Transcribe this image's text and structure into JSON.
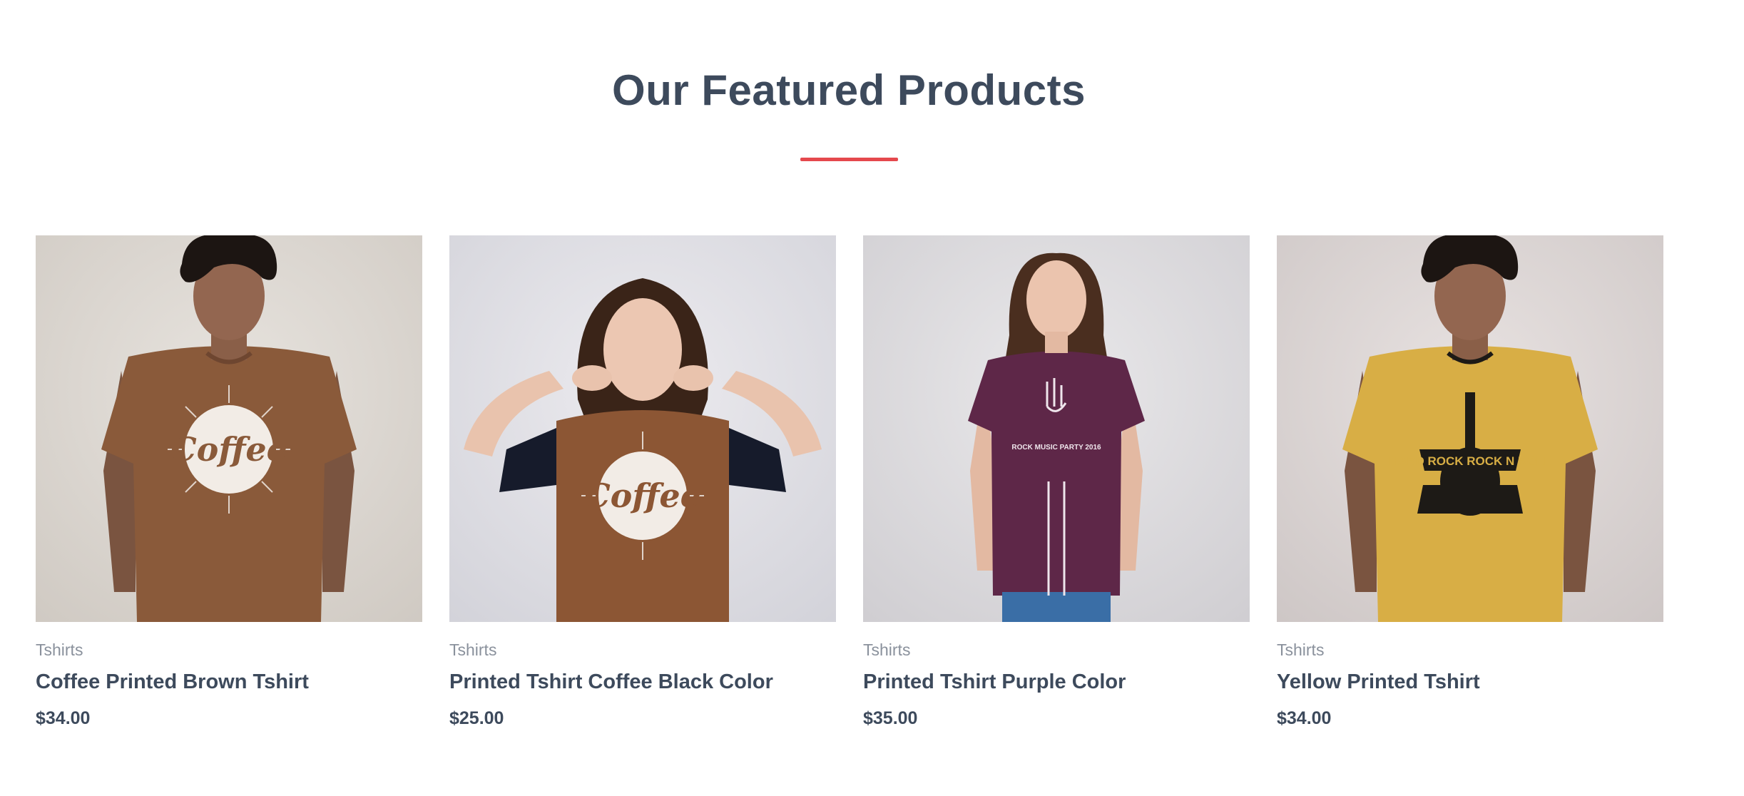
{
  "section": {
    "title": "Our Featured Products",
    "accent_color": "#e5484d"
  },
  "products": [
    {
      "category": "Tshirts",
      "name": "Coffee Printed Brown Tshirt",
      "price": "$34.00",
      "image": "photo of man wearing brown coffee print t-shirt",
      "shirt_color": "#8a5a3a",
      "print_text": "Coffee"
    },
    {
      "category": "Tshirts",
      "name": "Printed Tshirt Coffee Black Color",
      "price": "$25.00",
      "image": "photo of woman wearing brown raglan coffee print t-shirt with black sleeves",
      "shirt_color": "#8c5634",
      "sleeve_color": "#161b2b",
      "print_text": "Coffee"
    },
    {
      "category": "Tshirts",
      "name": "Printed Tshirt Purple Color",
      "price": "$35.00",
      "image": "photo of woman wearing purple rock music party t-shirt",
      "shirt_color": "#5e2748",
      "print_text": "ROCK MUSIC PARTY 2016"
    },
    {
      "category": "Tshirts",
      "name": "Yellow Printed Tshirt",
      "price": "$34.00",
      "image": "photo of man wearing yellow rock n roll guitar print t-shirt",
      "shirt_color": "#d8ae45",
      "print_text": "HARD ROCK ROCK N ROLL"
    }
  ]
}
